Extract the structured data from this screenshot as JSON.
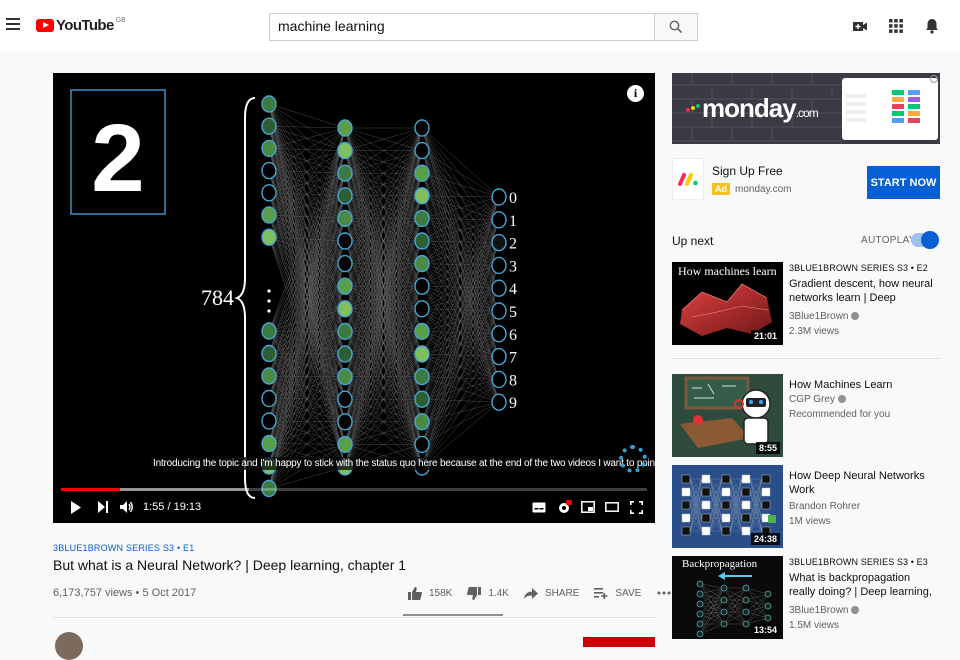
{
  "header": {
    "logo_text": "YouTube",
    "logo_country": "GB",
    "search_value": "machine learning"
  },
  "player": {
    "caption": "Introducing the topic and I'm happy to stick with the status quo here because at the end of the two videos I want to point",
    "time": "1:55 / 19:13",
    "progress_played": 0.1,
    "progress_loaded": 0.32,
    "digit": "2",
    "input_count": "784",
    "output_labels": [
      "0",
      "1",
      "2",
      "3",
      "4",
      "5",
      "6",
      "7",
      "8",
      "9"
    ]
  },
  "video": {
    "series": "3BLUE1BROWN SERIES  S3 • E1",
    "title": "But what is a Neural Network? | Deep learning, chapter 1",
    "views": "6,173,757 views • 5 Oct 2017",
    "likes": "158K",
    "dislikes": "1.4K",
    "share": "SHARE",
    "save": "SAVE"
  },
  "ad": {
    "brand": "monday",
    "brand_suffix": ".com",
    "title": "Sign Up Free",
    "badge": "Ad",
    "domain": "monday.com",
    "cta": "START NOW"
  },
  "upnext": {
    "label": "Up next",
    "autoplay": "AUTOPLAY",
    "items": [
      {
        "series": "3BLUE1BROWN SERIES  S3 • E2",
        "title": "Gradient descent, how neural networks learn | Deep learning...",
        "channel": "3Blue1Brown",
        "meta": "2.3M views",
        "duration": "21:01",
        "thumb_text": "How machines learn"
      },
      {
        "series": "",
        "title": "How Machines Learn",
        "channel": "CGP Grey",
        "meta": "Recommended for you",
        "duration": "8:55",
        "thumb_text": ""
      },
      {
        "series": "",
        "title": "How Deep Neural Networks Work",
        "channel": "Brandon Rohrer",
        "meta": "1M views",
        "duration": "24:38",
        "thumb_text": ""
      },
      {
        "series": "3BLUE1BROWN SERIES  S3 • E3",
        "title": "What is backpropagation really doing? | Deep learning, chapte...",
        "channel": "3Blue1Brown",
        "meta": "1.5M views",
        "duration": "13:54",
        "thumb_text": "Backpropagation"
      }
    ]
  }
}
